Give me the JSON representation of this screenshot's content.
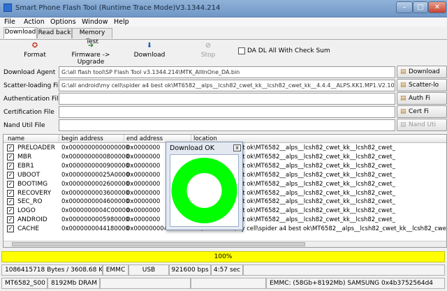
{
  "window": {
    "title": "Smart Phone Flash Tool (Runtime Trace Mode)V3.1344.214",
    "minimize": "–",
    "maximize": "□",
    "close": "✕"
  },
  "menu": [
    "File",
    "Action",
    "Options",
    "Window",
    "Help"
  ],
  "tabs": [
    "Download",
    "Read back",
    "Memory Test"
  ],
  "toolbar": {
    "format": "Format",
    "firmware_upgrade": "Firmware -> Upgrade",
    "download": "Download",
    "stop": "Stop",
    "da_checkbox": "DA DL All With Check Sum"
  },
  "fields": {
    "download_agent": {
      "label": "Download Agent",
      "value": "G:\\all flash tool\\SP Flash Tool v3.1344.214\\MTK_AllInOne_DA.bin",
      "button": "Download"
    },
    "scatter": {
      "label": "Scatter-loading File",
      "value": "G:\\all android\\my cell\\spider a4 best ok\\MT6582__alps__lcsh82_cwet_kk__lcsh82_cwet_kk__4.4.4__ALPS.KK1.MP1.V2.10\\",
      "button": "Scatter-lo"
    },
    "authentication": {
      "label": "Authentication File",
      "value": "",
      "button": "Auth Fi"
    },
    "certification": {
      "label": "Certification File",
      "value": "",
      "button": "Cert Fi"
    },
    "nand_util": {
      "label": "Nand Util File",
      "value": "",
      "button": "Nand Uti"
    }
  },
  "table": {
    "headers": [
      "name",
      "begin address",
      "end address",
      "location"
    ],
    "rows": [
      {
        "name": "PRELOADER",
        "begin": "0x0000000000000000",
        "end": "0x0000000",
        "loc": "ell\\spider a4 best ok\\MT6582__alps__lcsh82_cwet_kk__lcsh82_cwet_"
      },
      {
        "name": "MBR",
        "begin": "0x0000000000800000",
        "end": "0x0000000",
        "loc": "ell\\spider a4 best ok\\MT6582__alps__lcsh82_cwet_kk__lcsh82_cwet_"
      },
      {
        "name": "EBR1",
        "begin": "0x0000000000900000",
        "end": "0x0000000",
        "loc": "ell\\spider a4 best ok\\MT6582__alps__lcsh82_cwet_kk__lcsh82_cwet_"
      },
      {
        "name": "UBOOT",
        "begin": "0x00000000025A0000",
        "end": "0x0000000",
        "loc": "ell\\spider a4 best ok\\MT6582__alps__lcsh82_cwet_kk__lcsh82_cwet_"
      },
      {
        "name": "BOOTIMG",
        "begin": "0x0000000002600000",
        "end": "0x0000000",
        "loc": "ell\\spider a4 best ok\\MT6582__alps__lcsh82_cwet_kk__lcsh82_cwet_"
      },
      {
        "name": "RECOVERY",
        "begin": "0x0000000003600000",
        "end": "0x0000000",
        "loc": "ell\\spider a4 best ok\\MT6582__alps__lcsh82_cwet_kk__lcsh82_cwet_"
      },
      {
        "name": "SEC_RO",
        "begin": "0x0000000004600000",
        "end": "0x0000000",
        "loc": "ell\\spider a4 best ok\\MT6582__alps__lcsh82_cwet_kk__lcsh82_cwet_"
      },
      {
        "name": "LOGO",
        "begin": "0x0000000004C00000",
        "end": "0x0000000",
        "loc": "ell\\spider a4 best ok\\MT6582__alps__lcsh82_cwet_kk__lcsh82_cwet_"
      },
      {
        "name": "ANDROID",
        "begin": "0x0000000005980000",
        "end": "0x0000000",
        "loc": "ell\\spider a4 best ok\\MT6582__alps__lcsh82_cwet_kk__lcsh82_cwet_"
      },
      {
        "name": "CACHE",
        "begin": "0x0000000044180000",
        "end": "0x00000000441BFFFF",
        "loc": "G:\\all android\\my cell\\spider a4 best ok\\MT6582__alps__lcsh82_cwet_kk__lcsh82_cwet_"
      }
    ]
  },
  "dialog": {
    "title": "Download OK",
    "close": "x",
    "ring_color": "#00ff00"
  },
  "progress": {
    "text": "100%",
    "value": 1.0,
    "color": "#ffff00"
  },
  "status1": [
    "1086415718 Bytes / 3608.68 KBps",
    "EMMC",
    "USB",
    "921600 bps",
    "4:57 sec"
  ],
  "status2": [
    "MT6582_S00",
    "8192Mb DRAM",
    "",
    "",
    "EMMC: (58Gb+8192Mb) SAMSUNG 0x4b3752564d4"
  ]
}
